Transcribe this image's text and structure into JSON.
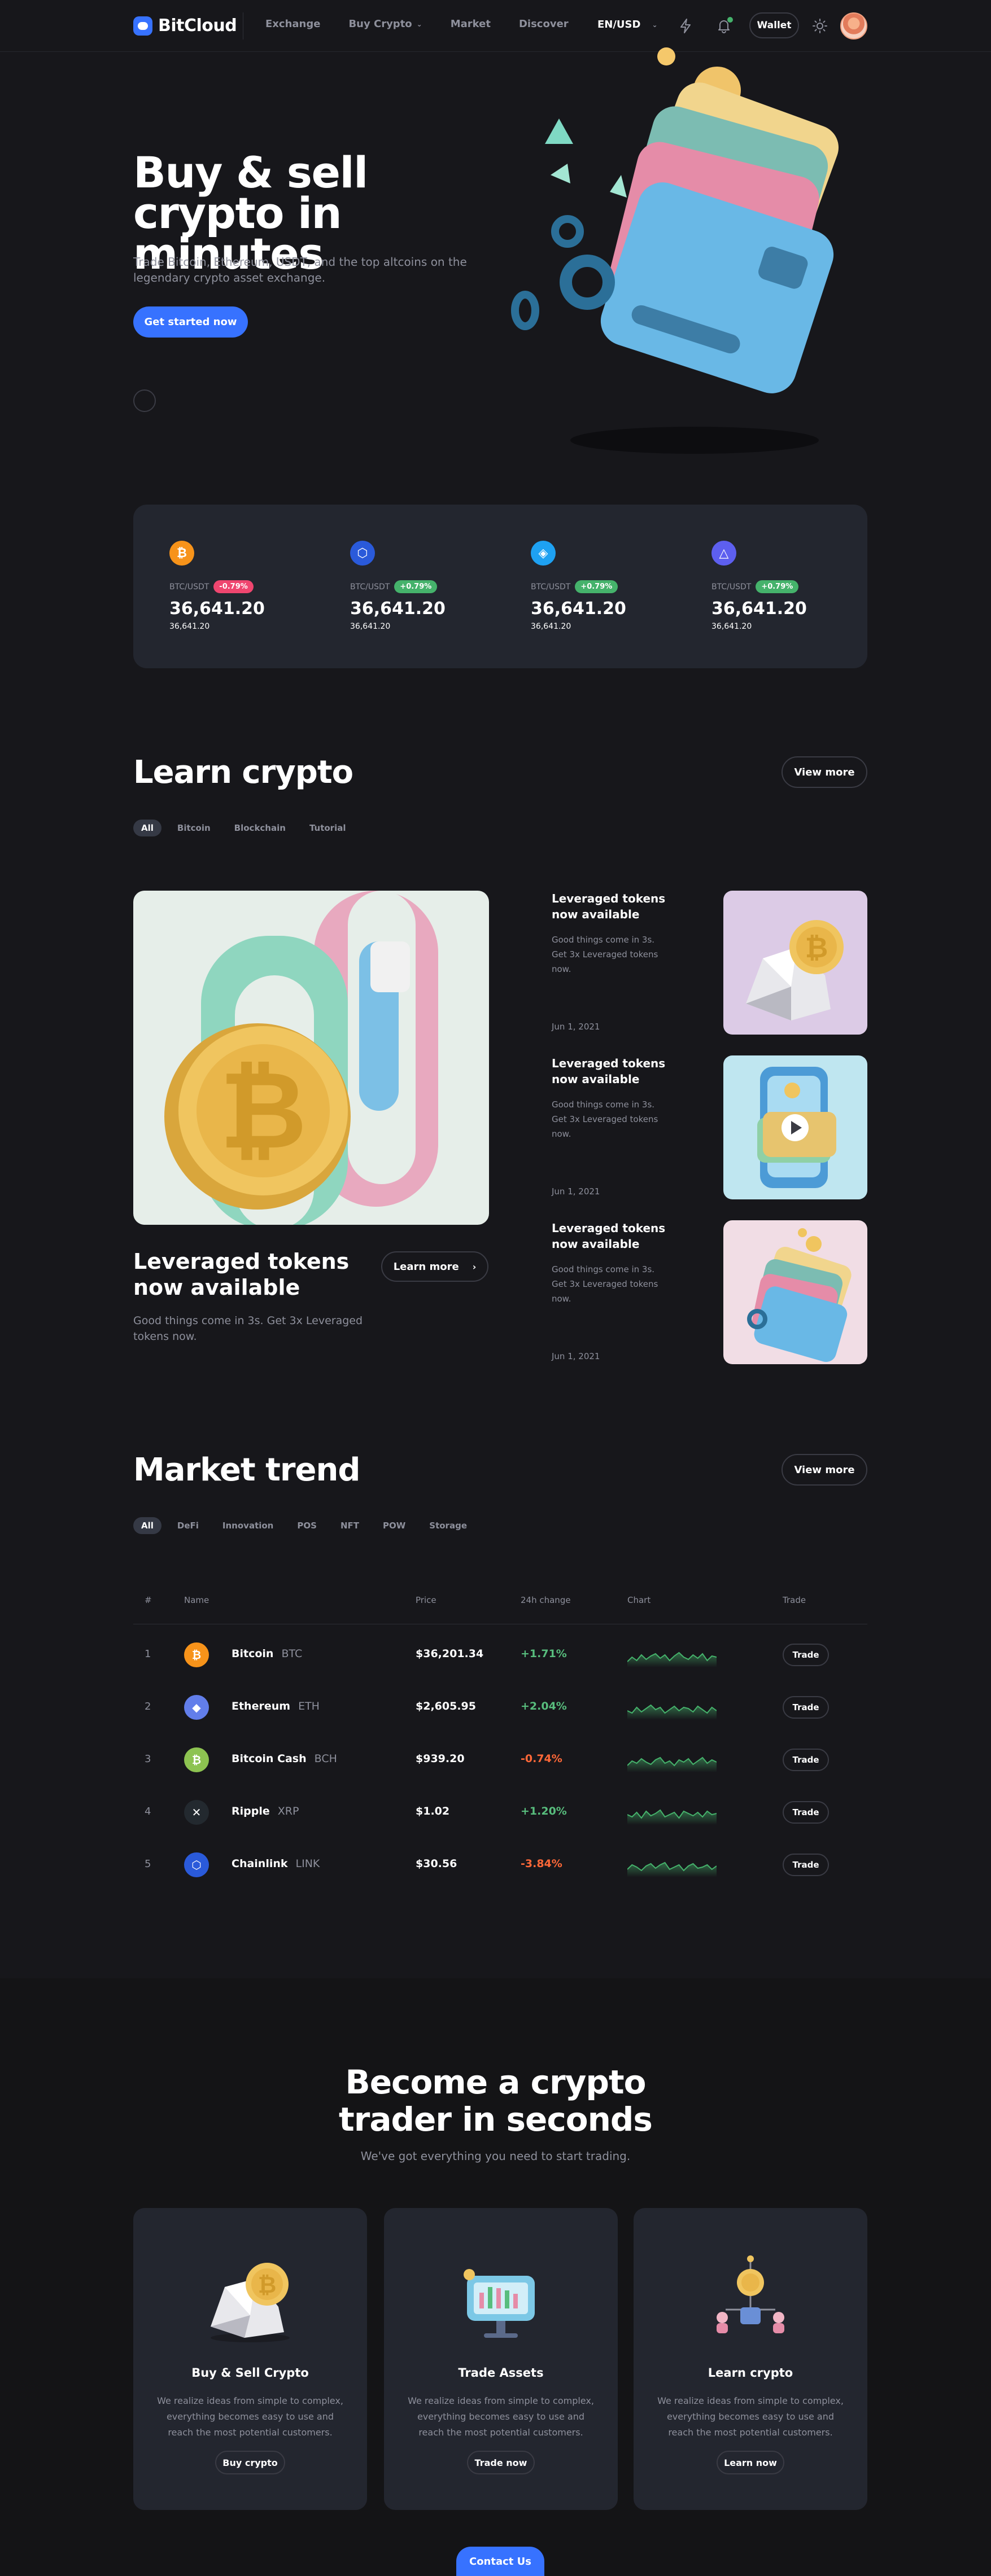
{
  "header": {
    "logo": "BitCloud",
    "nav": [
      {
        "label": "Exchange"
      },
      {
        "label": "Buy Crypto"
      },
      {
        "label": "Market"
      },
      {
        "label": "Discover"
      }
    ],
    "language": "EN/USD",
    "wallet_label": "Wallet"
  },
  "hero": {
    "title_line1": "Buy & sell",
    "title_line2": "crypto in minutes",
    "subtitle": "Trade Bitcoin, Ethereum, USDT, and the top altcoins on the legendary crypto asset exchange.",
    "cta": "Get started now"
  },
  "stats": [
    {
      "icon": "bitcoin-icon",
      "color": "#f7931a",
      "pair": "BTC/USDT",
      "change": "-0.79%",
      "change_color": "#ef466f",
      "value": "36,641.20",
      "small": "36,641.20"
    },
    {
      "icon": "chainlink-icon",
      "color": "#2a5ada",
      "pair": "BTC/USDT",
      "change": "+0.79%",
      "change_color": "#45b26b",
      "value": "36,641.20",
      "small": "36,641.20"
    },
    {
      "icon": "cube-icon",
      "color": "#1ea1f2",
      "pair": "BTC/USDT",
      "change": "+0.79%",
      "change_color": "#45b26b",
      "value": "36,641.20",
      "small": "36,641.20"
    },
    {
      "icon": "triangle-icon",
      "color": "#5d5fef",
      "pair": "BTC/USDT",
      "change": "+0.79%",
      "change_color": "#45b26b",
      "value": "36,641.20",
      "small": "36,641.20"
    }
  ],
  "learn": {
    "title": "Learn crypto",
    "view_more": "View more",
    "tabs": [
      "All",
      "Bitcoin",
      "Blockchain",
      "Tutorial"
    ],
    "featured": {
      "title": "Leveraged tokens now available",
      "subtitle": "Good things come in 3s. Get 3x Leveraged tokens now.",
      "button": "Learn more"
    },
    "posts": [
      {
        "title": "Leveraged tokens now available",
        "subtitle": "Good things come in 3s. Get 3x Leveraged tokens now.",
        "date": "Jun 1, 2021"
      },
      {
        "title": "Leveraged tokens now available",
        "subtitle": "Good things come in 3s. Get 3x Leveraged tokens now.",
        "date": "Jun 1, 2021"
      },
      {
        "title": "Leveraged tokens now available",
        "subtitle": "Good things come in 3s. Get 3x Leveraged tokens now.",
        "date": "Jun 1, 2021"
      }
    ]
  },
  "market": {
    "title": "Market trend",
    "view_more": "View more",
    "tabs": [
      "All",
      "DeFi",
      "Innovation",
      "POS",
      "NFT",
      "POW",
      "Storage"
    ],
    "columns": {
      "num": "#",
      "name": "Name",
      "price": "Price",
      "change": "24h change",
      "chart": "Chart",
      "trade": "Trade"
    },
    "rows": [
      {
        "num": "1",
        "name": "Bitcoin",
        "symbol": "BTC",
        "price": "$36,201.34",
        "change": "+1.71%",
        "change_color": "#58bd7d",
        "icon": "bitcoin-icon",
        "color": "#f7931a",
        "glyph": "₿"
      },
      {
        "num": "2",
        "name": "Ethereum",
        "symbol": "ETH",
        "price": "$2,605.95",
        "change": "+2.04%",
        "change_color": "#58bd7d",
        "icon": "ethereum-icon",
        "color": "#627eea",
        "glyph": "◆"
      },
      {
        "num": "3",
        "name": "Bitcoin Cash",
        "symbol": "BCH",
        "price": "$939.20",
        "change": "-0.74%",
        "change_color": "#ff6838",
        "icon": "bitcoin-cash-icon",
        "color": "#8dc351",
        "glyph": "₿"
      },
      {
        "num": "4",
        "name": "Ripple",
        "symbol": "XRP",
        "price": "$1.02",
        "change": "+1.20%",
        "change_color": "#58bd7d",
        "icon": "ripple-icon",
        "color": "#23292f",
        "glyph": "✕"
      },
      {
        "num": "5",
        "name": "Chainlink",
        "symbol": "LINK",
        "price": "$30.56",
        "change": "-3.84%",
        "change_color": "#ff6838",
        "icon": "chainlink-icon",
        "color": "#2a5ada",
        "glyph": "⬡"
      }
    ],
    "trade_label": "Trade"
  },
  "become": {
    "title_line1": "Become a crypto",
    "title_line2": "trader in seconds",
    "subtitle": "We've got everything you need to start trading.",
    "cards": [
      {
        "title": "Buy & Sell Crypto",
        "text": "We realize ideas from simple to complex, everything becomes easy to use and reach the most potential customers.",
        "button": "Buy crypto"
      },
      {
        "title": "Trade Assets",
        "text": "We realize ideas from simple to complex, everything becomes easy to use and reach the most potential customers.",
        "button": "Trade now"
      },
      {
        "title": "Learn crypto",
        "text": "We realize ideas from simple to complex, everything becomes easy to use and reach the most potential customers.",
        "button": "Learn now"
      }
    ],
    "contact": "Contact Us"
  },
  "colors": {
    "accent": "#3772ff",
    "positive": "#45b26b",
    "negative": "#ef466f"
  }
}
